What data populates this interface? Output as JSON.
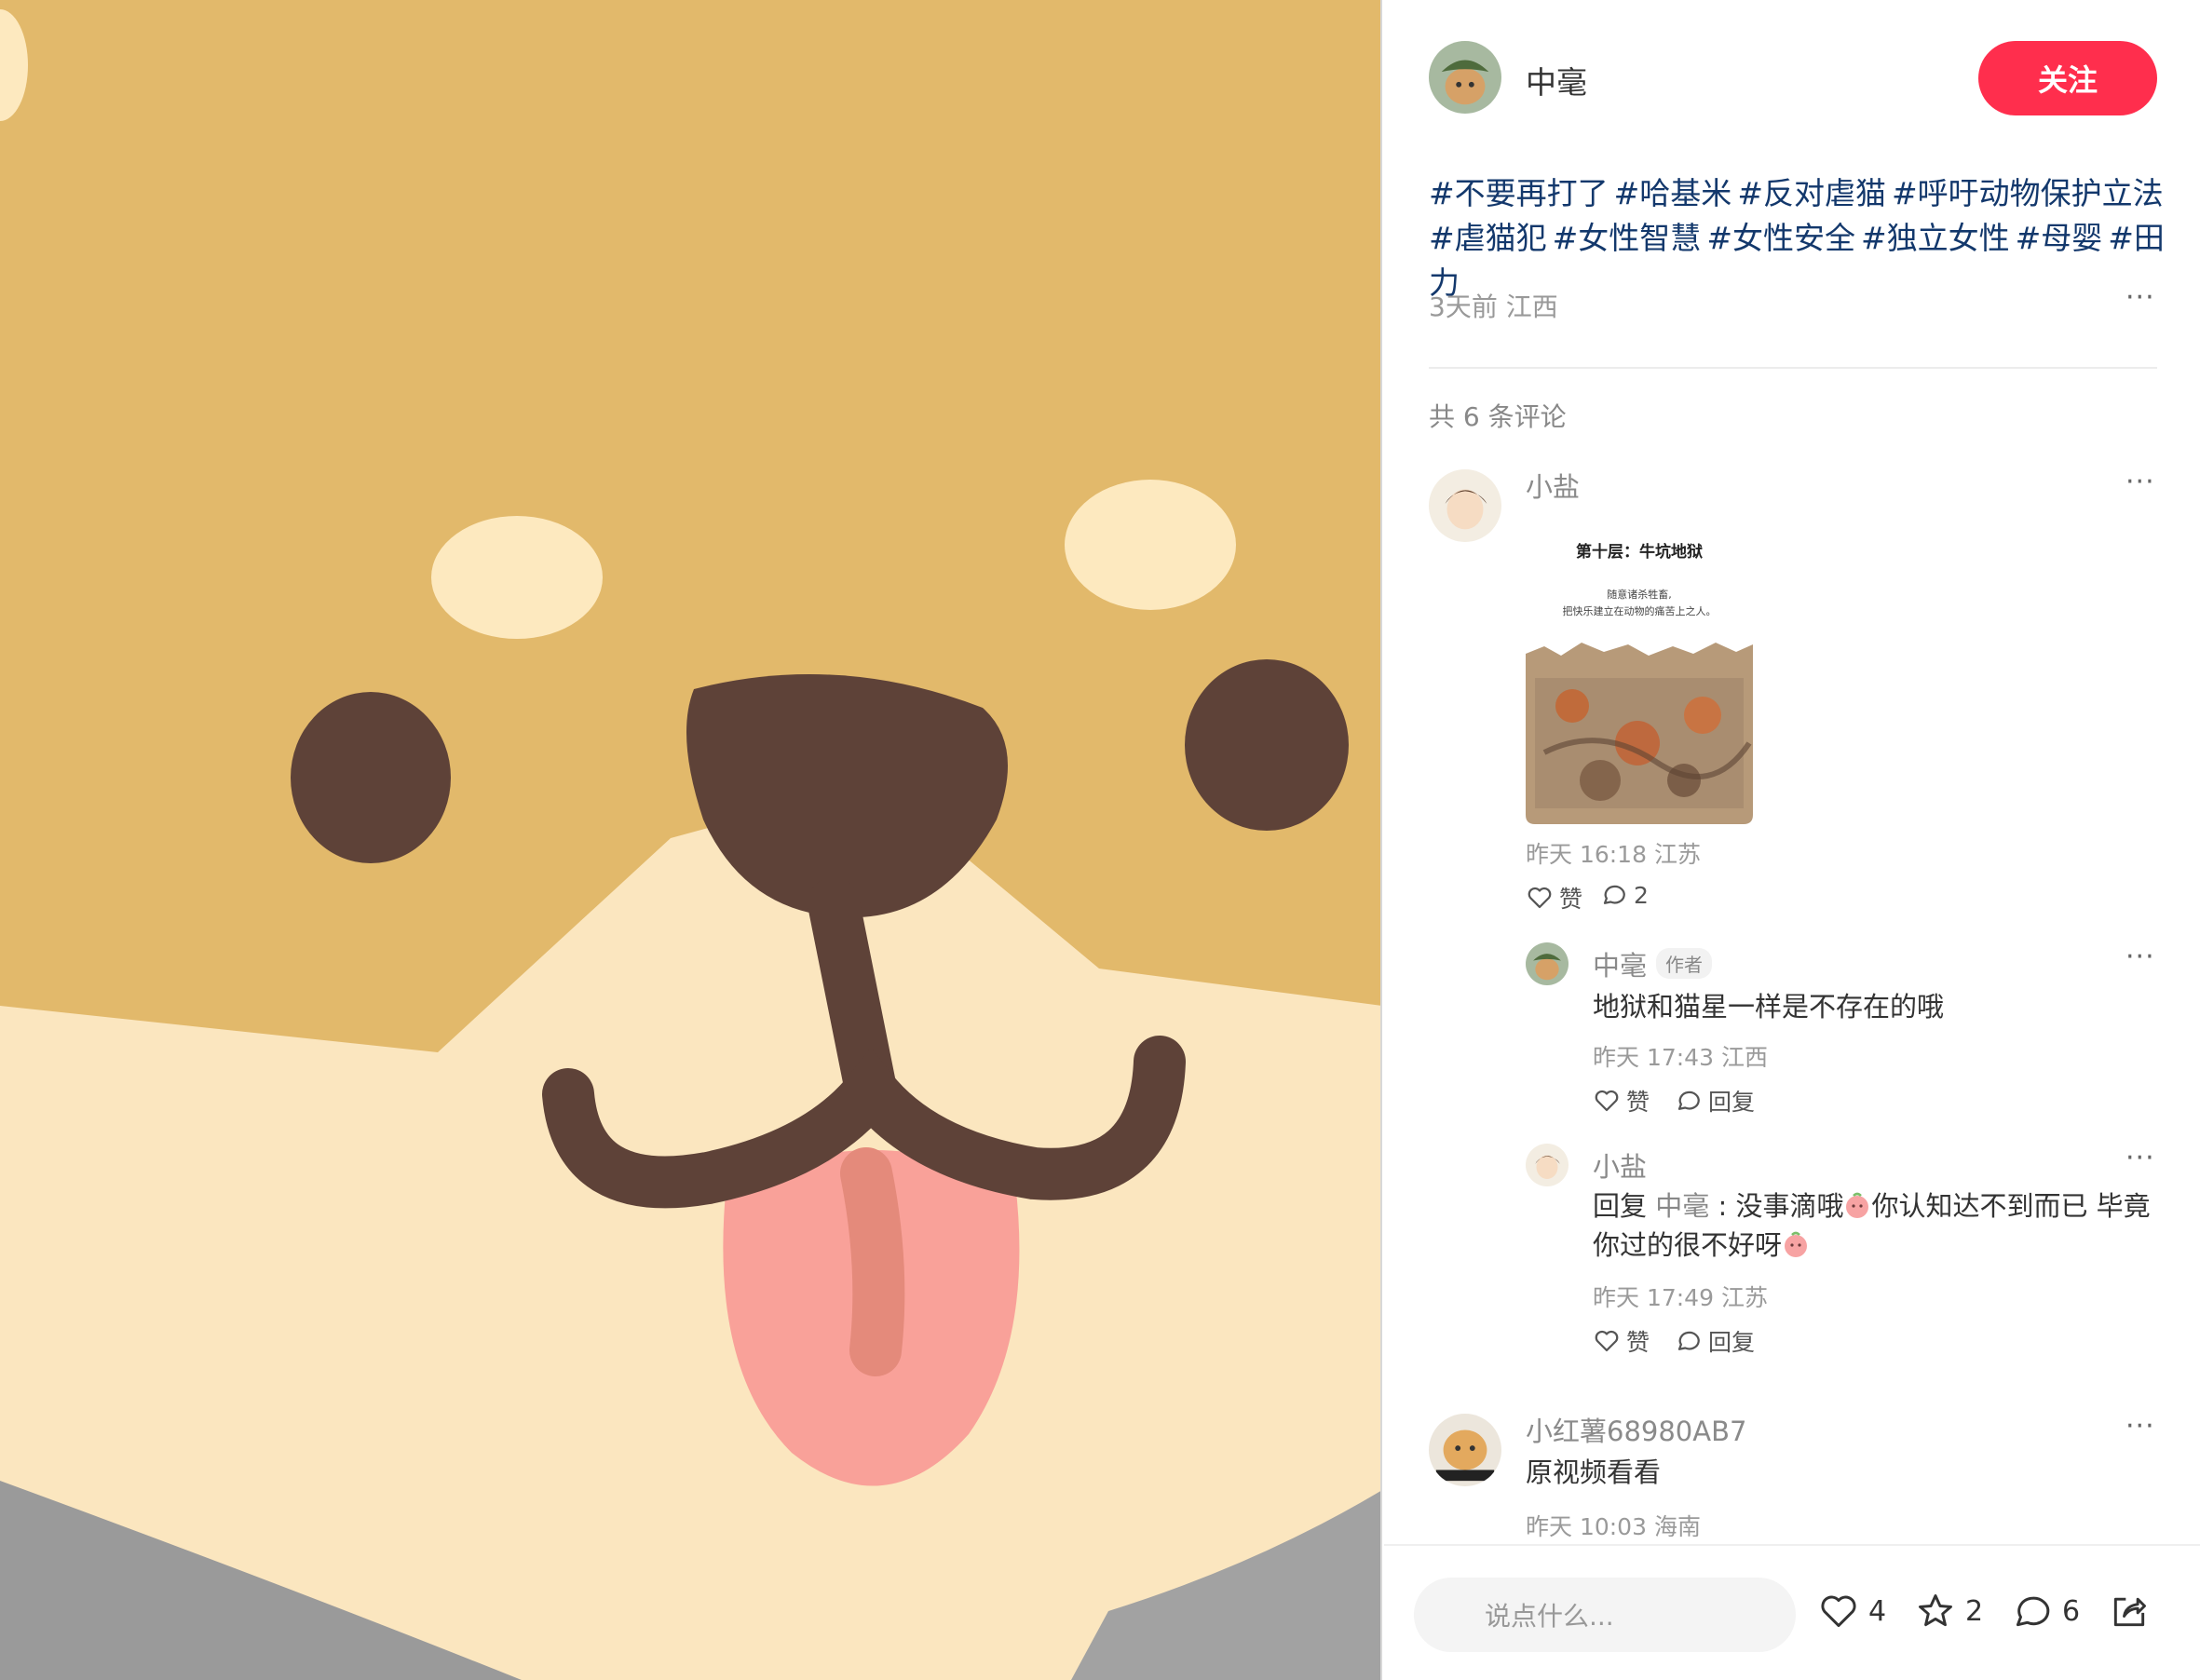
{
  "author": {
    "name": "中毫",
    "follow_label": "关注"
  },
  "post": {
    "tags": [
      "#不要再打了",
      "#哈基米",
      "#反对虐猫",
      "#呼吁动物保护立法",
      "#虐猫犯",
      "#女性智慧",
      "#女性安全",
      "#独立女性",
      "#母婴",
      "#田力"
    ],
    "time": "3天前",
    "location": "江西"
  },
  "comments_header": "共 6 条评论",
  "comments": [
    {
      "name": "小盐",
      "image": {
        "title": "第十层：牛坑地狱",
        "subtitle_1": "随意诸杀牲畜,",
        "subtitle_2": "把快乐建立在动物的痛苦上之人。"
      },
      "time": "昨天 16:18",
      "location": "江苏",
      "like_label": "赞",
      "reply_count": "2",
      "replies": [
        {
          "name": "中毫",
          "badge": "作者",
          "text": "地狱和猫星一样是不存在的哦",
          "time": "昨天 17:43",
          "location": "江西",
          "like_label": "赞",
          "reply_label": "回复"
        },
        {
          "name": "小盐",
          "reply_prefix": "回复",
          "mention": "中毫",
          "text_1": " : 没事滴哦",
          "text_2": "你认知达不到而已 毕竟",
          "text_3": "你过的很不好呀",
          "time": "昨天 17:49",
          "location": "江苏",
          "like_label": "赞",
          "reply_label": "回复"
        }
      ]
    },
    {
      "name": "小红薯68980AB7",
      "text": "原视频看看",
      "time": "昨天 10:03",
      "location": "海南"
    }
  ],
  "bottom_bar": {
    "input_placeholder": "说点什么...",
    "likes": "4",
    "stars": "2",
    "comments": "6"
  },
  "colors": {
    "accent": "#ff2e4d",
    "tag_blue": "#13386c",
    "media_bg": "#e2b96b"
  },
  "icons": [
    "heart-icon",
    "comment-icon",
    "star-icon",
    "share-icon",
    "more-icon"
  ]
}
